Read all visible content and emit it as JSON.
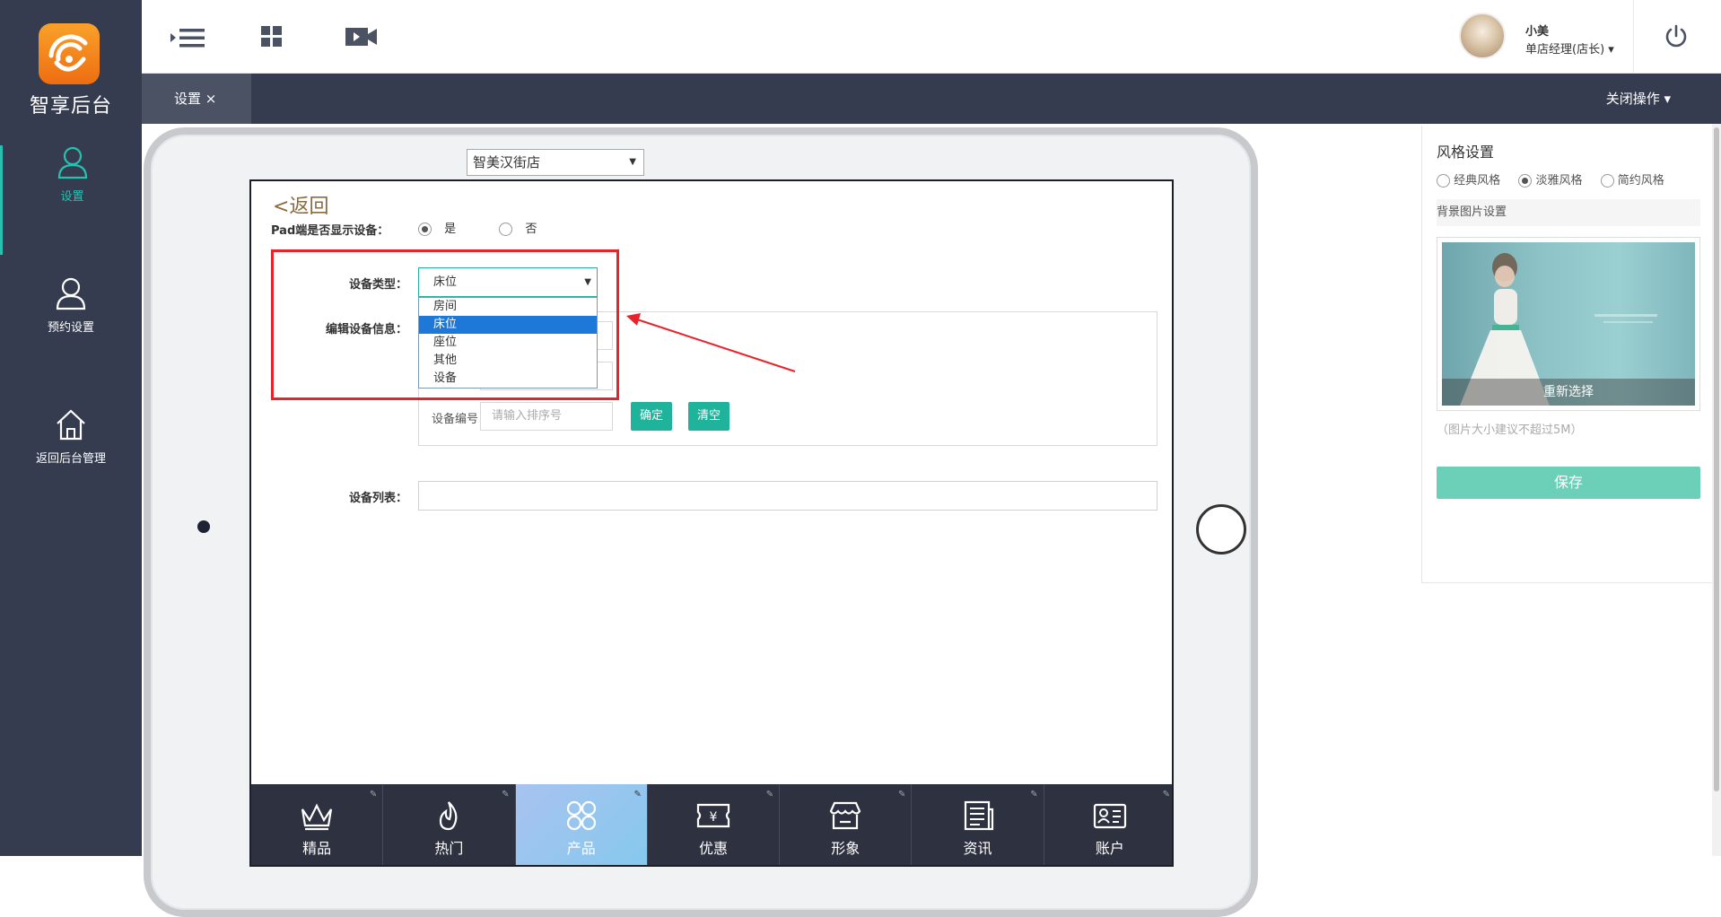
{
  "app": {
    "logo_text": "智享后台"
  },
  "sidebar": {
    "items": [
      {
        "label": "设置",
        "icon": "user-icon",
        "active": true
      },
      {
        "label": "预约设置",
        "icon": "user-icon",
        "active": false
      },
      {
        "label": "返回后台管理",
        "icon": "home-icon",
        "active": false
      }
    ]
  },
  "header": {
    "icons": [
      "menu-collapse-icon",
      "grid-icon",
      "video-icon"
    ],
    "user_name": "小美",
    "user_role": "单店经理(店长) ▾",
    "power_icon": "power-icon"
  },
  "tabs": {
    "active_label": "设置 ×",
    "close_ops": "关闭操作 ▾"
  },
  "ipad": {
    "store_select": "智美汉街店",
    "back": "返回",
    "pad_show_label": "Pad端是否显示设备：",
    "pad_show_yes": "是",
    "pad_show_no": "否",
    "device_type_label": "设备类型：",
    "device_type_value": "床位",
    "device_type_options": [
      "房间",
      "床位",
      "座位",
      "其他",
      "设备"
    ],
    "device_type_selected_index": 1,
    "edit_info_label": "编辑设备信息：",
    "device_no_label": "设备编号：",
    "device_no_placeholder": "请输入排序号",
    "confirm_label": "确定",
    "clear_label": "清空",
    "device_list_label": "设备列表：",
    "bottom_nav": [
      {
        "label": "精品",
        "icon": "crown-icon"
      },
      {
        "label": "热门",
        "icon": "flame-icon"
      },
      {
        "label": "产品",
        "icon": "product-icon",
        "active": true
      },
      {
        "label": "优惠",
        "icon": "coupon-icon"
      },
      {
        "label": "形象",
        "icon": "store-icon"
      },
      {
        "label": "资讯",
        "icon": "news-icon"
      },
      {
        "label": "账户",
        "icon": "account-card-icon"
      }
    ]
  },
  "right_panel": {
    "title": "风格设置",
    "styles": [
      "经典风格",
      "淡雅风格",
      "简约风格"
    ],
    "selected_style_index": 1,
    "bg_title": "背景图片设置",
    "reselect": "重新选择",
    "hint": "（图片大小建议不超过5M）",
    "save": "保存"
  },
  "colors": {
    "sidebar_bg": "#353c50",
    "accent": "#28c0b0",
    "button_green": "#1fb39c",
    "save_green": "#6ccfb7",
    "highlight_red": "#e8232a",
    "dropdown_selected": "#1e78d8"
  }
}
